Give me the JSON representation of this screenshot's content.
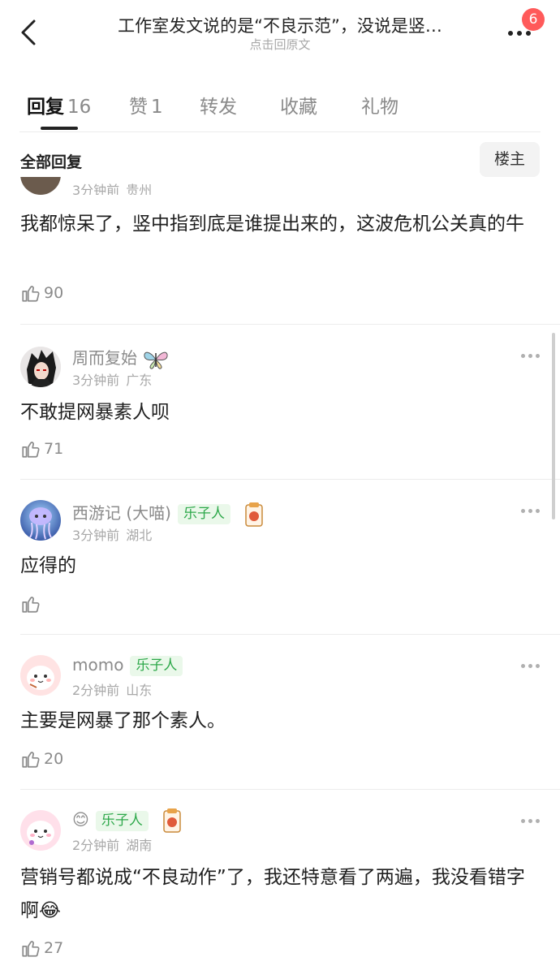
{
  "header": {
    "title": "工作室发文说的是“不良示范”，没说是竖…",
    "subtitle": "点击回原文",
    "notification_count": "6"
  },
  "tabs": [
    {
      "label": "回复",
      "count": "16"
    },
    {
      "label": "赞",
      "count": "1"
    },
    {
      "label": "转发",
      "count": ""
    },
    {
      "label": "收藏",
      "count": ""
    },
    {
      "label": "礼物",
      "count": ""
    }
  ],
  "filter": {
    "label": "全部回复",
    "owner_button": "楼主"
  },
  "comments": [
    {
      "username": "",
      "time": "3分钟前",
      "location": "贵州",
      "body": "我都惊呆了，竖中指到底是谁提出来的，这波危机公关真的牛",
      "likes": "90"
    },
    {
      "username": "周而复始",
      "time": "3分钟前",
      "location": "广东",
      "body": "不敢提网暴素人呗",
      "likes": "71",
      "badge_icon": "butterfly-icon"
    },
    {
      "username": "西游记 (大喵)",
      "tag": "乐子人",
      "time": "3分钟前",
      "location": "湖北",
      "body": "应得的",
      "likes": "",
      "badge_icon": "mahjong-fa-icon"
    },
    {
      "username": "momo",
      "tag": "乐子人",
      "time": "2分钟前",
      "location": "山东",
      "body": "主要是网暴了那个素人。",
      "likes": "20"
    },
    {
      "username": "😊",
      "tag": "乐子人",
      "time": "2分钟前",
      "location": "湖南",
      "body": "营销号都说成“不良动作”了，我还特意看了两遍，我没看错字啊😂",
      "likes": "27",
      "badge_icon": "mahjong-fa-icon"
    }
  ],
  "colors": {
    "tag_bg": "#eaf8ea",
    "tag_text": "#2da84a",
    "badge": "#ff5a5a"
  }
}
